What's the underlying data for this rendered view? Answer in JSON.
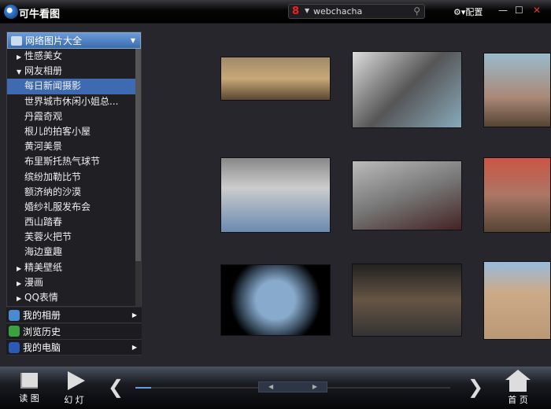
{
  "app": {
    "title": "可牛看图"
  },
  "search": {
    "value": "webchacha"
  },
  "window": {
    "config_label": "配置"
  },
  "sidebar": {
    "header": "网络图片大全",
    "items": [
      {
        "label": "性感美女",
        "level": 0,
        "expander": "collapsed"
      },
      {
        "label": "网友相册",
        "level": 0,
        "expander": "expanded"
      },
      {
        "label": "每日新闻摄影",
        "level": 1,
        "selected": true
      },
      {
        "label": "世界城市休闲小姐总...",
        "level": 1
      },
      {
        "label": "丹霞奇观",
        "level": 1
      },
      {
        "label": "根儿的拍客小屋",
        "level": 1
      },
      {
        "label": "黄河美景",
        "level": 1
      },
      {
        "label": "布里斯托热气球节",
        "level": 1
      },
      {
        "label": "缤纷加勒比节",
        "level": 1
      },
      {
        "label": "额济纳的沙漠",
        "level": 1
      },
      {
        "label": "婚纱礼服发布会",
        "level": 1
      },
      {
        "label": "西山踏春",
        "level": 1
      },
      {
        "label": "芙蓉火把节",
        "level": 1
      },
      {
        "label": "海边童趣",
        "level": 1
      },
      {
        "label": "精美壁纸",
        "level": 0,
        "expander": "collapsed"
      },
      {
        "label": "漫画",
        "level": 0,
        "expander": "collapsed"
      },
      {
        "label": "QQ表情",
        "level": 0,
        "expander": "collapsed"
      }
    ],
    "nav": [
      {
        "label": "我的相册",
        "has_arrow": true
      },
      {
        "label": "浏览历史",
        "has_arrow": false
      },
      {
        "label": "我的电脑",
        "has_arrow": true
      }
    ]
  },
  "toolbar": {
    "read": "读 图",
    "slideshow": "幻 灯",
    "home": "首 页"
  },
  "colors": {
    "selection": "#3d6ab0",
    "background": "#26262c"
  }
}
